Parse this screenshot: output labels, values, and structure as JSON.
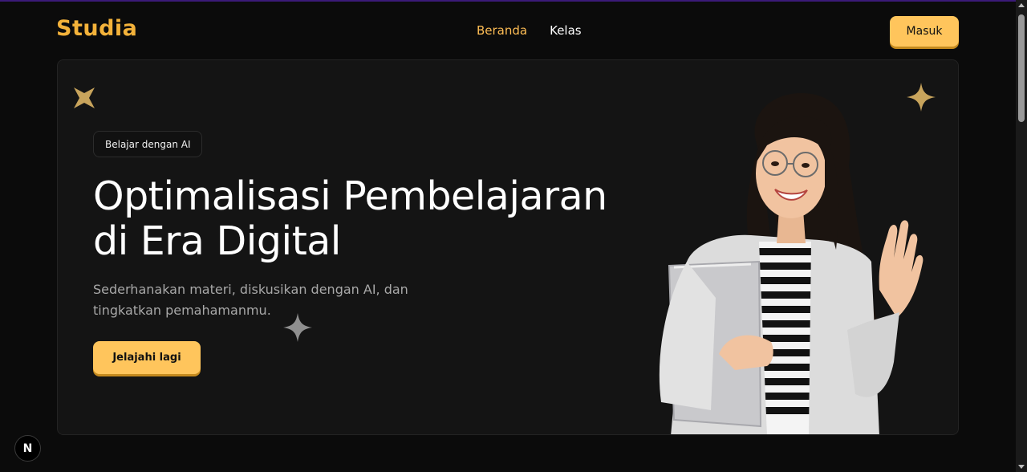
{
  "brand": {
    "logo_text": "Studia"
  },
  "nav": {
    "items": [
      "Beranda",
      "Kelas"
    ],
    "active": "Beranda"
  },
  "header": {
    "login_label": "Masuk"
  },
  "hero": {
    "badge": "Belajar dengan AI",
    "headline_line1": "Optimalisasi Pembelajaran",
    "headline_line2": "di Era Digital",
    "subtitle_line1": "Sederhanakan materi, diskusikan dengan AI, dan",
    "subtitle_line2": "tingkatkan pemahamanmu.",
    "cta_label": "Jelajahi lagi"
  },
  "dev_indicator": {
    "label": "N"
  },
  "colors": {
    "accent": "#ffc55c",
    "logo": "#f3b23a",
    "star": "#c8a45c",
    "background": "#0b0b0b",
    "card": "#141414"
  },
  "icons": [
    "sparkle-icon",
    "next-logo-icon"
  ]
}
